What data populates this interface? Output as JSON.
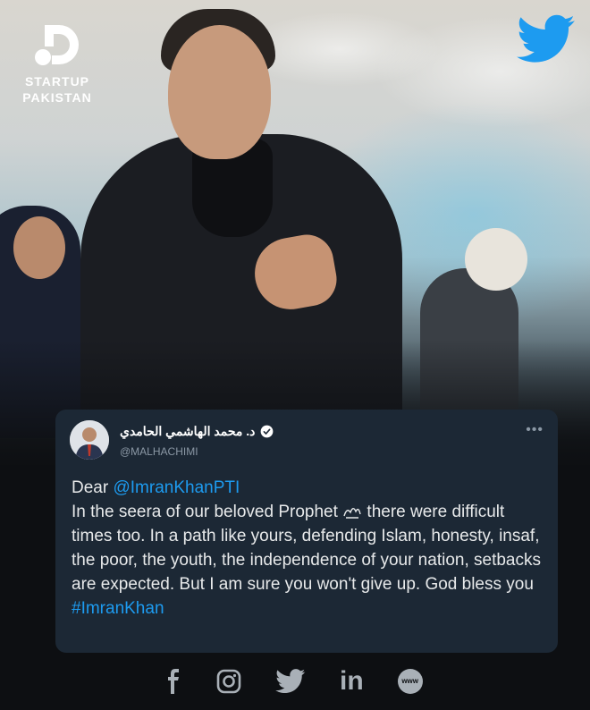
{
  "branding": {
    "logo_line1": "STARTUP",
    "logo_line2": "PAKISTAN"
  },
  "tweet": {
    "display_name": "د. محمد الهاشمي الحامدي",
    "handle": "@MALHACHIMI",
    "greeting": "Dear ",
    "mention": "@ImranKhanPTI",
    "text_before_glyph": "In the seera of our beloved Prophet ",
    "text_after_glyph": " there were difficult times too. In a path like yours, defending Islam, honesty, insaf, the poor, the youth, the independence of your nation, setbacks are expected. But I am sure you won't give up. God bless you",
    "hashtag": "#ImranKhan",
    "more_label": "•••"
  },
  "social": {
    "icons": [
      "facebook-icon",
      "instagram-icon",
      "twitter-icon",
      "linkedin-icon",
      "website-icon"
    ],
    "linkedin_label": "in",
    "website_label": "www"
  },
  "colors": {
    "card_bg": "#1c2835",
    "link": "#1d9bf0",
    "twitter_blue": "#1d9bf0"
  }
}
